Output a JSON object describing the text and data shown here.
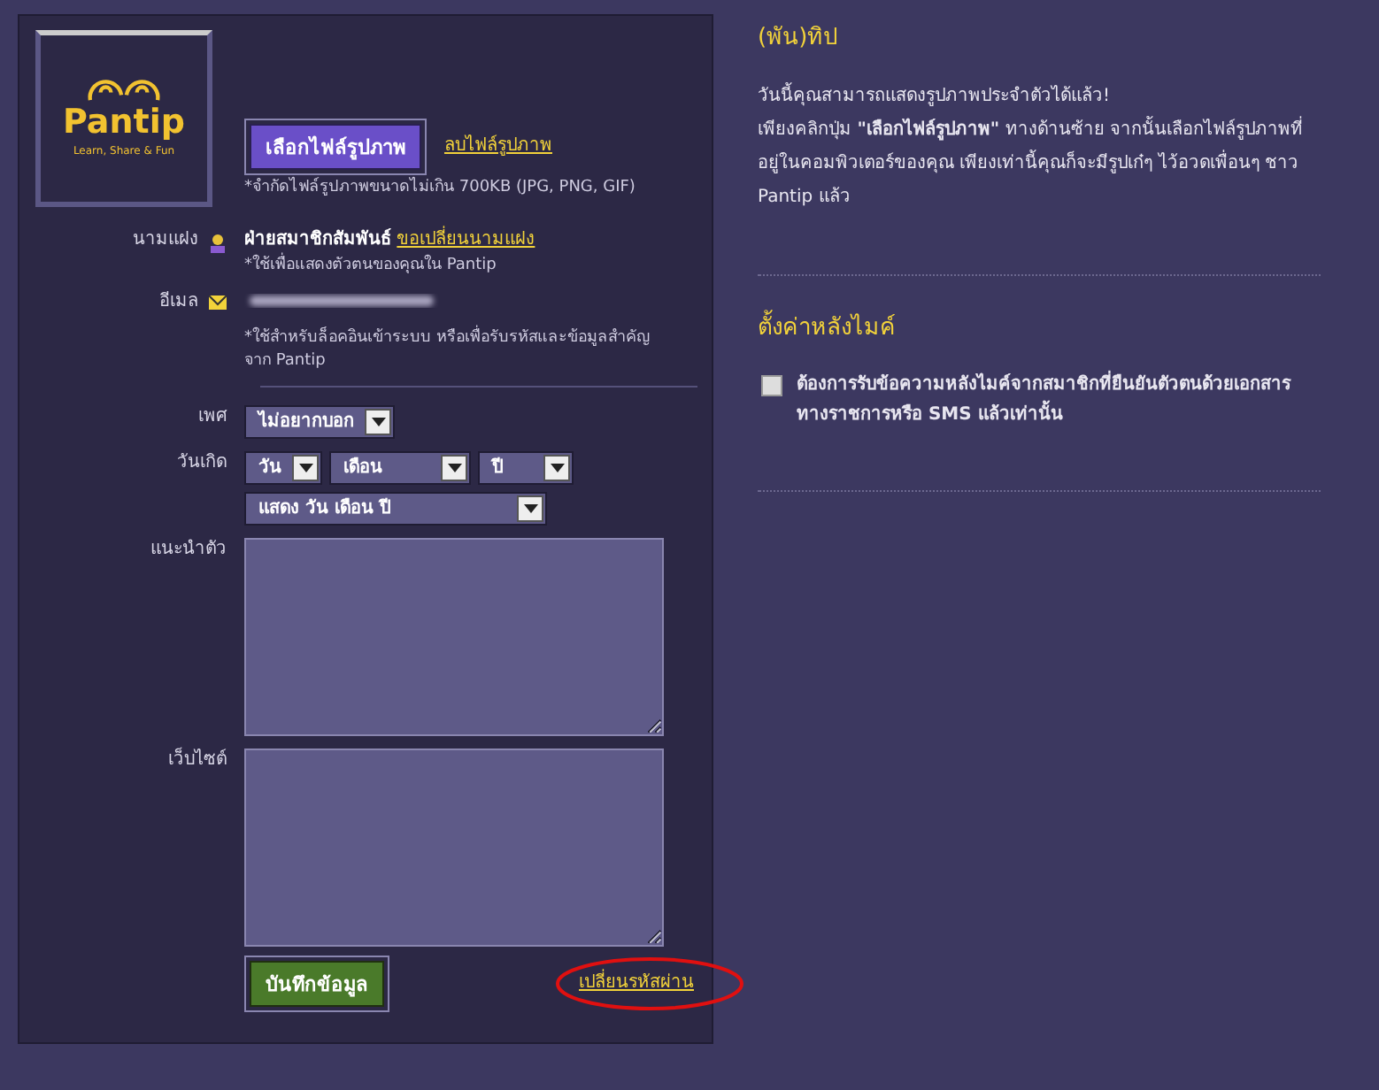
{
  "avatar": {
    "logo_name": "Pantip",
    "logo_tagline": "Learn, Share & Fun"
  },
  "photo": {
    "choose_button": "เลือกไฟล์รูปภาพ",
    "delete_link": "ลบไฟล์รูปภาพ",
    "hint": "*จำกัดไฟล์รูปภาพขนาดไม่เกิน 700KB (JPG, PNG, GIF)"
  },
  "alias": {
    "label": "นามแฝง",
    "value": "ฝ่ายสมาชิกสัมพันธ์",
    "change_link": "ขอเปลี่ยนนามแฝง",
    "hint": "*ใช้เพื่อแสดงตัวตนของคุณใน Pantip"
  },
  "email": {
    "label": "อีเมล",
    "hint": "*ใช้สำหรับล็อคอินเข้าระบบ หรือเพื่อรับรหัสและข้อมูลสำคัญจาก Pantip"
  },
  "gender": {
    "label": "เพศ",
    "value": "ไม่อยากบอก"
  },
  "birthday": {
    "label": "วันเกิด",
    "day": "วัน",
    "month": "เดือน",
    "year": "ปี",
    "display": "แสดง วัน เดือน ปี"
  },
  "intro": {
    "label": "แนะนำตัว"
  },
  "website": {
    "label": "เว็บไซต์"
  },
  "save_button": "บันทึกข้อมูล",
  "change_password_link": "เปลี่ยนรหัสผ่าน",
  "tip": {
    "title": "(พัน)ทิป",
    "lines": [
      "วันนี้คุณสามารถแสดงรูปภาพประจำตัวได้แล้ว!",
      "เพียงคลิกปุ่ม **\"เลือกไฟล์รูปภาพ\"** ทางด้านซ้าย จากนั้นเลือกไฟล์รูปภาพที่อยู่ในคอมพิวเตอร์ของคุณ เพียงเท่านี้คุณก็จะมีรูปเก๋ๆ ไว้อวดเพื่อนๆ ชาว Pantip แล้ว"
    ]
  },
  "mic_settings": {
    "title": "ตั้งค่าหลังไมค์",
    "option": {
      "label": "ต้องการรับข้อความหลังไมค์จากสมาชิกที่ยืนยันตัวตนด้วยเอกสารทางราชการหรือ SMS แล้วเท่านั้น",
      "checked": false
    }
  }
}
